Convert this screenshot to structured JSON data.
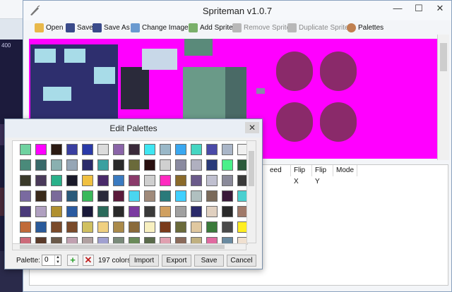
{
  "background": {
    "ruler_value": "400"
  },
  "main_window": {
    "title": "Spriteman v1.0.7",
    "controls": {
      "minimize": "—",
      "maximize": "☐",
      "close": "✕"
    },
    "toolbar": {
      "open": "Open",
      "save": "Save",
      "save_as": "Save As",
      "change_image": "Change Image",
      "add_sprite": "Add Sprite",
      "remove_sprite": "Remove Sprite",
      "duplicate_sprite": "Duplicate Sprite",
      "palettes": "Palettes"
    },
    "grid_headers": [
      "eed",
      "Flip X",
      "Flip Y",
      "Mode"
    ]
  },
  "dialog": {
    "title": "Edit Palettes",
    "close": "✕",
    "palette_label": "Palette:",
    "palette_value": "0",
    "color_count": "197 colors",
    "buttons": {
      "import": "Import",
      "export": "Export",
      "save": "Save",
      "cancel": "Cancel"
    },
    "add_icon": "+",
    "delete_icon": "✕",
    "swatch_rows": [
      [
        "#6fd2a0",
        "#ff00ff",
        "#2b1a12",
        "#3a3fa0",
        "#2a3aa8",
        "#dcdcdc",
        "#8a64a8",
        "#3a2a3a",
        "#3fe6f2",
        "#9ab8c8",
        "#3aa8f0",
        "#46d6c2",
        "#4a4aa8",
        "#aab6c8",
        "#f0f0f0"
      ],
      [
        "#4a8a7a",
        "#3a6a6a",
        "#8ab0b0",
        "#96a6b6",
        "#2a2a6a",
        "#3aa0a0",
        "#2a2a2a",
        "#6a6a3a",
        "#2a1010",
        "#d0d0d0",
        "#8a8aa0",
        "#b0b0c0",
        "#2a3a7a",
        "#4af08a",
        "#2a5a3a"
      ],
      [
        "#3a3a2a",
        "#4a3a5a",
        "#2ab08a",
        "#1a1a2a",
        "#f0c040",
        "#4a2a6a",
        "#3a7ac0",
        "#8a3a6a",
        "#cfcfcf",
        "#ff2ac0",
        "#8a6a2a",
        "#6a5a8a",
        "#c0c0d0",
        "#8a8a9a",
        "#3a3a3a"
      ],
      [
        "#7a6aa0",
        "#3a2a1a",
        "#7a6a9a",
        "#2a5a7a",
        "#3ab85a",
        "#2a2a3a",
        "#5a1a3a",
        "#4ad6f0",
        "#a08a7a",
        "#2a7a7a",
        "#40d0ff",
        "#b0c0c0",
        "#7a6a5a",
        "#3a1a3a",
        "#4ad0d0"
      ],
      [
        "#4a3a7a",
        "#b0a0c0",
        "#b09030",
        "#2a5aa0",
        "#1a1a3a",
        "#2a6a5a",
        "#2a2a2a",
        "#7a3aa0",
        "#3a3a3a",
        "#d0a060",
        "#a0a0a0",
        "#2a2a6a",
        "#e0d0c0",
        "#2a2a2a",
        "#a07a6a"
      ],
      [
        "#c06a3a",
        "#2a5a9a",
        "#7a4a2a",
        "#7a4a2a",
        "#d0c060",
        "#f0d080",
        "#aa8a4a",
        "#8a6a3a",
        "#f8f0c0",
        "#7a3a1a",
        "#6a6a3a",
        "#e0c8a0",
        "#3a7a3a",
        "#4a4a4a",
        "#ffee22"
      ],
      [
        "#cc6a7a",
        "#5a3a2a",
        "#6a5a4a",
        "#c0a0b0",
        "#b0a0a0",
        "#a0a0d0",
        "#7a8a7a",
        "#6a8a5a",
        "#5a6a4a",
        "#e0a0b0",
        "#8a6a5a",
        "#c0b080",
        "#e06aa0",
        "#6a8aa0",
        "#f0e0d0"
      ]
    ]
  }
}
